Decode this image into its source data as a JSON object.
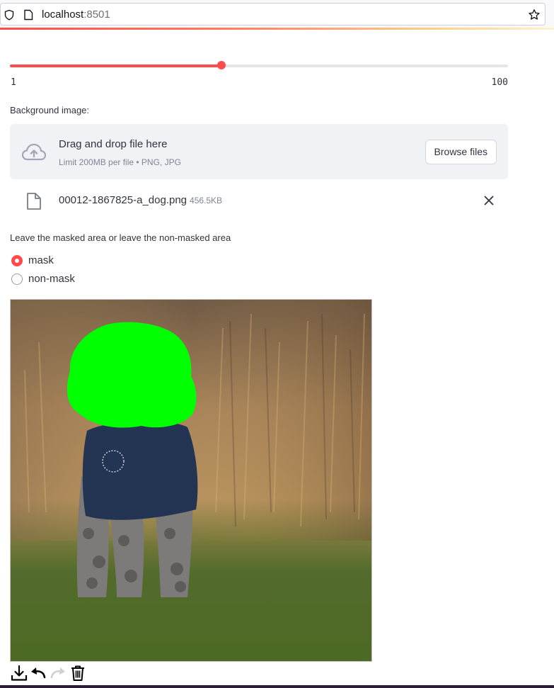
{
  "browser": {
    "url_host": "localhost",
    "url_port": ":8501"
  },
  "slider": {
    "min_label": "1",
    "max_label": "100",
    "value_fraction": 0.425,
    "accent_color": "#ff4b4b"
  },
  "uploader": {
    "label": "Background image:",
    "drop_title": "Drag and drop file here",
    "drop_subtitle": "Limit 200MB per file • PNG, JPG",
    "browse_label": "Browse files",
    "file_name": "00012-1867825-a_dog.png",
    "file_size": "456.5KB"
  },
  "mask_option": {
    "label": "Leave the masked area or leave the non-masked area",
    "options": [
      "mask",
      "non-mask"
    ],
    "selected": "mask"
  },
  "canvas": {
    "mask_color": "#00ff00",
    "toolbar_icons": [
      "download-icon",
      "undo-icon",
      "redo-icon",
      "trash-icon"
    ]
  }
}
